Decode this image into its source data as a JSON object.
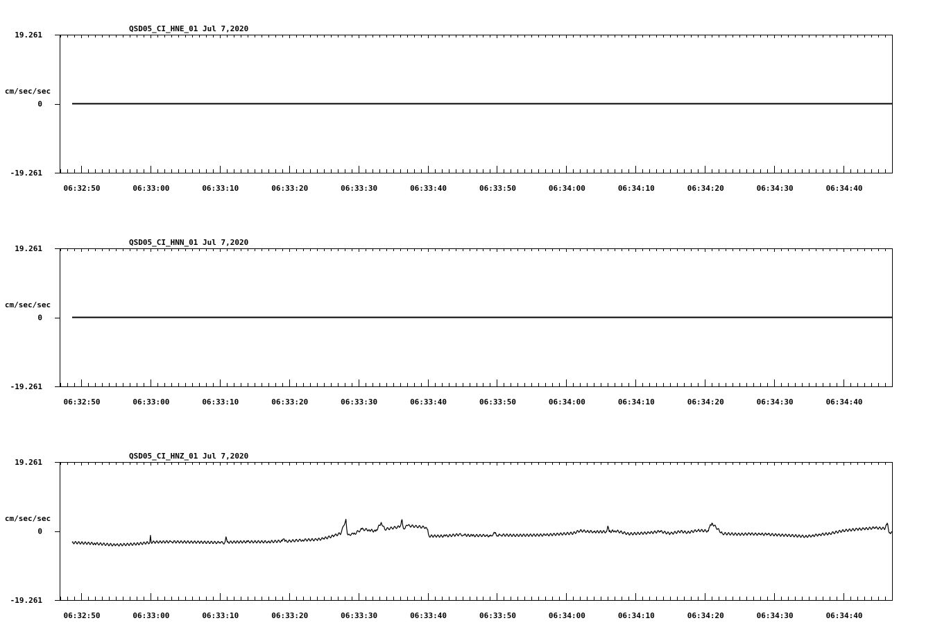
{
  "chart_data": [
    {
      "type": "line",
      "title": "QSD05_CI_HNE_01  Jul 7,2020",
      "ylabel": "cm/sec/sec",
      "ylim": [
        -19.261,
        19.261
      ],
      "y_tick_labels": [
        "19.261",
        "0",
        "-19.261"
      ],
      "x_tick_labels": [
        "06:32:50",
        "06:33:00",
        "06:33:10",
        "06:33:20",
        "06:33:30",
        "06:33:40",
        "06:33:50",
        "06:34:00",
        "06:34:10",
        "06:34:20",
        "06:34:30",
        "06:34:40"
      ],
      "x_range_seconds": [
        -3,
        117
      ],
      "series": [
        {
          "x": [
            -1.3,
            117
          ],
          "values": [
            0,
            0
          ]
        }
      ]
    },
    {
      "type": "line",
      "title": "QSD05_CI_HNN_01  Jul 7,2020",
      "ylabel": "cm/sec/sec",
      "ylim": [
        -19.261,
        19.261
      ],
      "y_tick_labels": [
        "19.261",
        "0",
        "-19.261"
      ],
      "x_tick_labels": [
        "06:32:50",
        "06:33:00",
        "06:33:10",
        "06:33:20",
        "06:33:30",
        "06:33:40",
        "06:33:50",
        "06:34:00",
        "06:34:10",
        "06:34:20",
        "06:34:30",
        "06:34:40"
      ],
      "x_range_seconds": [
        -3,
        117
      ],
      "series": [
        {
          "x": [
            -1.3,
            117
          ],
          "values": [
            0,
            0
          ]
        }
      ]
    },
    {
      "type": "line",
      "title": "QSD05_CI_HNZ_01  Jul 7,2020",
      "ylabel": "cm/sec/sec",
      "ylim": [
        -19.261,
        19.261
      ],
      "y_tick_labels": [
        "19.261",
        "0",
        "-19.261"
      ],
      "x_tick_labels": [
        "06:32:50",
        "06:33:00",
        "06:33:10",
        "06:33:20",
        "06:33:30",
        "06:33:40",
        "06:33:50",
        "06:34:00",
        "06:34:10",
        "06:34:20",
        "06:34:30",
        "06:34:40"
      ],
      "x_range_seconds": [
        -3,
        117
      ],
      "series": [
        {
          "x": [
            -1.3,
            2.0,
            5.0,
            8.0,
            9.9,
            10.0,
            10.1,
            13.0,
            17.0,
            20.0,
            20.7,
            20.9,
            21.1,
            24.0,
            27.0,
            29.0,
            29.2,
            29.4,
            32.0,
            34.0,
            35.0,
            36.5,
            37.5,
            38.2,
            38.4,
            38.6,
            39.3,
            40.5,
            41.6,
            42.5,
            43.3,
            43.8,
            46.0,
            46.3,
            46.5,
            47.1,
            49.8,
            50.0,
            50.2,
            52.5,
            54.5,
            55.2,
            56.5,
            58.5,
            59.0,
            59.7,
            60.1,
            60.5,
            62.5,
            67.0,
            71.0,
            72.0,
            73.0,
            74.0,
            75.8,
            76.0,
            76.2,
            77.0,
            79.0,
            82.0,
            83.5,
            85.0,
            86.5,
            87.5,
            89.0,
            90.5,
            90.7,
            91.0,
            92.5,
            95.0,
            96.5,
            98.0,
            99.0,
            100.5,
            102.0,
            104.5,
            105.5,
            106.5,
            108.0,
            110.0,
            112.0,
            113.0,
            114.5,
            116.0,
            116.3,
            116.6,
            117.0
          ],
          "values": [
            -3.2,
            -3.5,
            -3.9,
            -3.6,
            -3.2,
            -1.2,
            -3.1,
            -3.0,
            -3.1,
            -3.2,
            -3.3,
            -1.6,
            -3.1,
            -3.0,
            -3.0,
            -2.8,
            -2.2,
            -2.9,
            -2.5,
            -2.4,
            -2.1,
            -1.3,
            -0.6,
            3.3,
            -0.8,
            -0.9,
            -0.9,
            0.5,
            0.3,
            -0.1,
            2.4,
            0.5,
            1.2,
            3.2,
            0.7,
            1.5,
            1.0,
            0.4,
            -1.4,
            -1.4,
            -1.0,
            -1.1,
            -1.3,
            -1.2,
            -1.4,
            -0.6,
            -1.3,
            -1.1,
            -1.2,
            -1.1,
            -0.6,
            0.1,
            -0.1,
            -0.2,
            -0.2,
            1.4,
            -0.2,
            0.1,
            -0.8,
            -0.5,
            -0.1,
            -0.7,
            -0.1,
            -0.4,
            0.2,
            0.0,
            1.2,
            2.2,
            -0.7,
            -0.9,
            -0.8,
            -0.9,
            -0.9,
            -1.1,
            -1.2,
            -1.5,
            -1.3,
            -1.0,
            -0.7,
            0.1,
            0.5,
            0.6,
            0.9,
            0.7,
            2.2,
            -0.5,
            -0.3
          ]
        }
      ]
    }
  ]
}
